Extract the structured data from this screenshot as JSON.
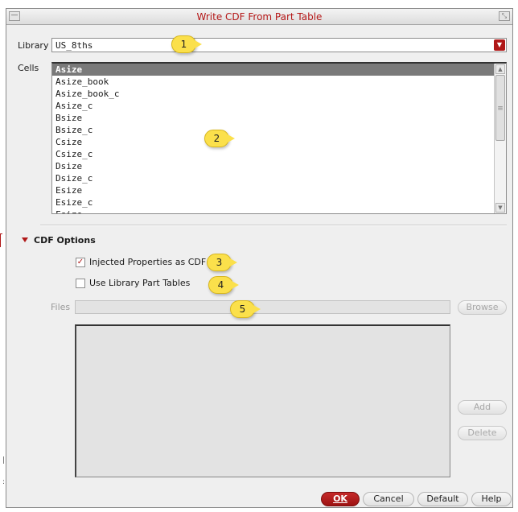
{
  "window": {
    "title": "Write CDF From Part Table"
  },
  "library": {
    "label": "Library",
    "value": "US_8ths"
  },
  "cells": {
    "label": "Cells",
    "items": [
      "Asize",
      "Asize_book",
      "Asize_book_c",
      "Asize_c",
      "Bsize",
      "Bsize_c",
      "Csize",
      "Csize_c",
      "Dsize",
      "Dsize_c",
      "Esize",
      "Esize_c",
      "Fsize"
    ],
    "selected_index": 0
  },
  "cdf_options": {
    "title": "CDF Options",
    "injected_properties": {
      "label": "Injected Properties as CDF",
      "checked": true
    },
    "use_library_part_tables": {
      "label": "Use Library Part Tables",
      "checked": false
    }
  },
  "files": {
    "label": "Files",
    "value": ""
  },
  "buttons": {
    "browse": "Browse",
    "add": "Add",
    "delete": "Delete",
    "ok": "OK",
    "cancel": "Cancel",
    "default": "Default",
    "help": "Help"
  },
  "callouts": [
    "1",
    "2",
    "3",
    "4",
    "5"
  ],
  "colors": {
    "accent": "#b01818",
    "callout": "#fbe04b",
    "selection": "#7a7a7a"
  }
}
